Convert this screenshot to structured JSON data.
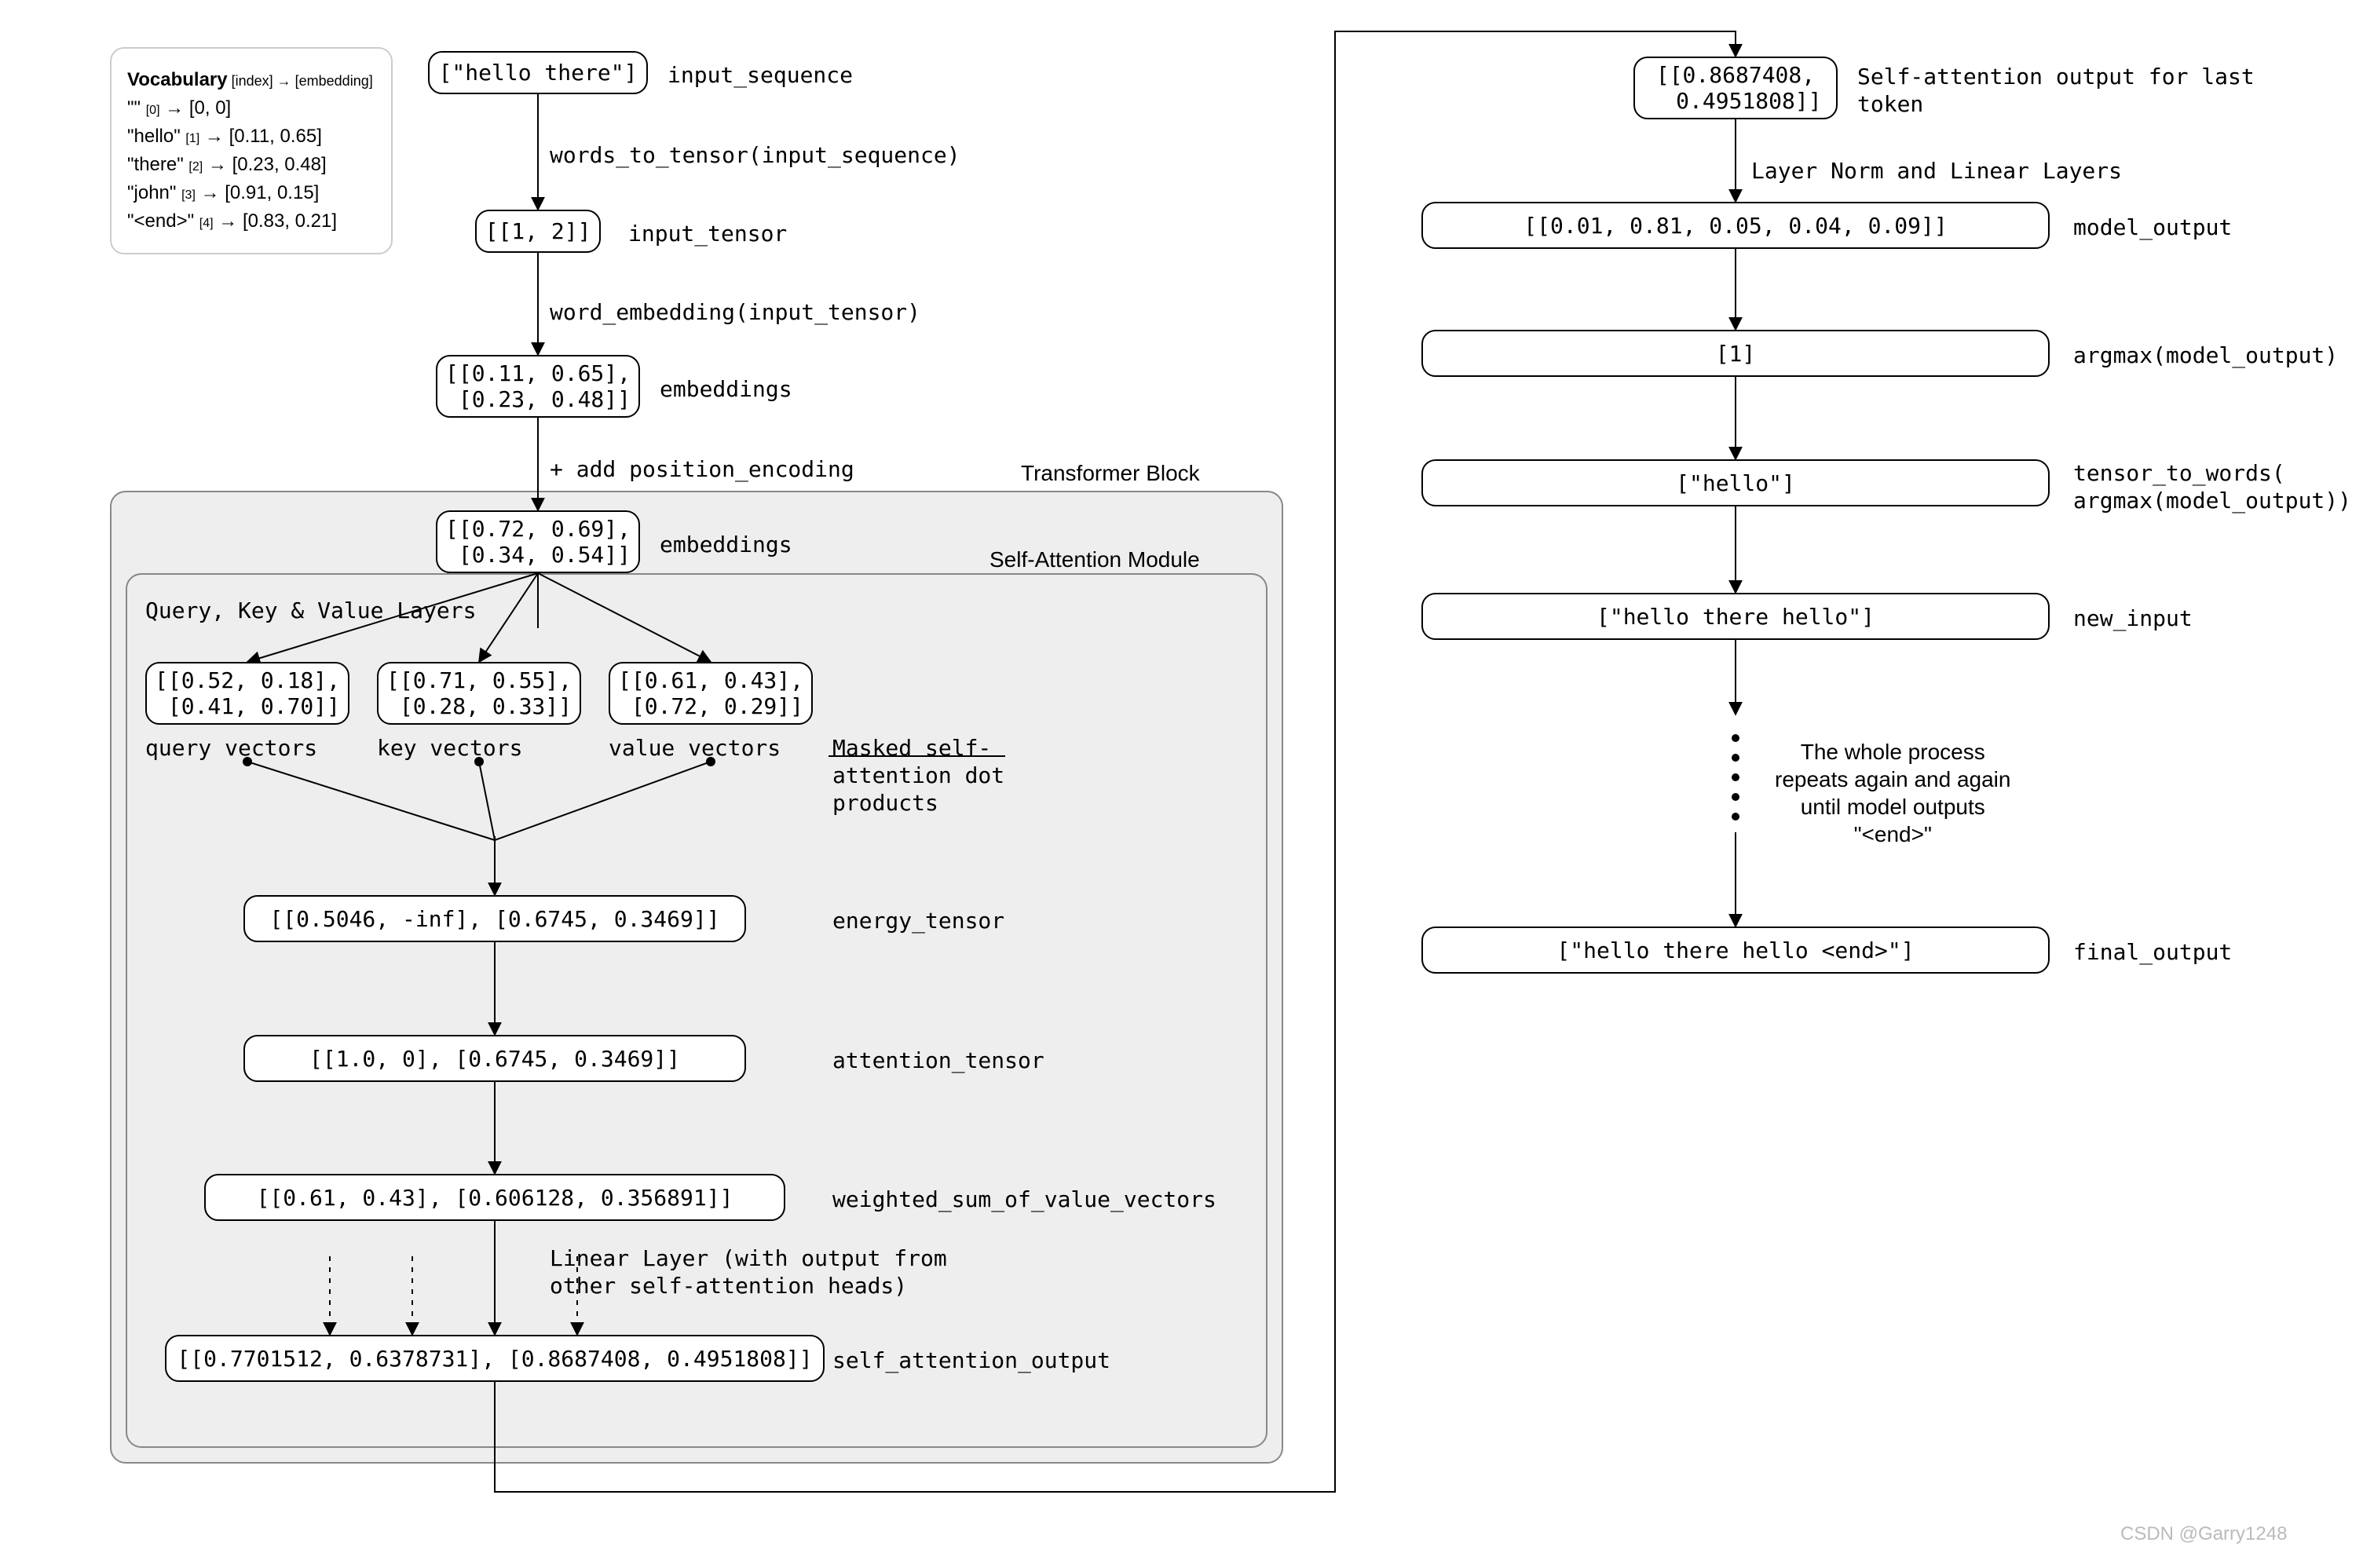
{
  "vocab": {
    "heading": "Vocabulary",
    "heading_meta": " [index] → [embedding]",
    "rows": [
      {
        "tok": "\"\"",
        "idx": "[0]",
        "emb": "[0, 0]"
      },
      {
        "tok": "\"hello\"",
        "idx": "[1]",
        "emb": "[0.11, 0.65]"
      },
      {
        "tok": "\"there\"",
        "idx": "[2]",
        "emb": "[0.23, 0.48]"
      },
      {
        "tok": "\"john\"",
        "idx": "[3]",
        "emb": "[0.91, 0.15]"
      },
      {
        "tok": "\"<end>\"",
        "idx": "[4]",
        "emb": "[0.83, 0.21]"
      }
    ]
  },
  "left": {
    "input_sequence": {
      "val": "[\"hello there\"]",
      "lbl": "input_sequence"
    },
    "step1": "words_to_tensor(input_sequence)",
    "input_tensor": {
      "val": "[[1, 2]]",
      "lbl": "input_tensor"
    },
    "step2": "word_embedding(input_tensor)",
    "embeddings1": {
      "val": "[[0.11, 0.65],\n [0.23, 0.48]]",
      "lbl": "embeddings"
    },
    "step3": "+ add position_encoding",
    "transformer_title": "Transformer Block",
    "self_attn_title": "Self-Attention Module",
    "embeddings2": {
      "val": "[[0.72, 0.69],\n [0.34, 0.54]]",
      "lbl": "embeddings"
    },
    "qkv_title": "Query, Key & Value Layers",
    "q": {
      "val": "[[0.52, 0.18],\n [0.41, 0.70]]",
      "lbl": "query vectors"
    },
    "k": {
      "val": "[[0.71, 0.55],\n [0.28, 0.33]]",
      "lbl": "key vectors"
    },
    "v": {
      "val": "[[0.61, 0.43],\n [0.72, 0.29]]",
      "lbl": "value vectors"
    },
    "mask_lbl": "Masked self-\nattention dot\nproducts",
    "energy": {
      "val": "[[0.5046, -inf], [0.6745, 0.3469]]",
      "lbl": "energy_tensor"
    },
    "attention": {
      "val": "[[1.0, 0], [0.6745, 0.3469]]",
      "lbl": "attention_tensor"
    },
    "wsum": {
      "val": "[[0.61, 0.43], [0.606128, 0.356891]]",
      "lbl": "weighted_sum_of_value_vectors"
    },
    "linear_lbl": "Linear Layer (with output from\nother self-attention heads)",
    "self_out": {
      "val": "[[0.7701512, 0.6378731], [0.8687408, 0.4951808]]",
      "lbl": "self_attention_output"
    }
  },
  "right": {
    "sa_last": {
      "val": "[[0.8687408,\n  0.4951808]]",
      "lbl": "Self-attention output for last\ntoken"
    },
    "step_ln": "Layer Norm and Linear Layers",
    "model_output": {
      "val": "[[0.01, 0.81, 0.05, 0.04, 0.09]]",
      "lbl": "model_output"
    },
    "argmax": {
      "val": "[1]",
      "lbl": "argmax(model_output)"
    },
    "t2w": {
      "val": "[\"hello\"]",
      "lbl": "tensor_to_words(\nargmax(model_output))"
    },
    "new_input": {
      "val": "[\"hello there hello\"]",
      "lbl": "new_input"
    },
    "repeat": "The whole process\nrepeats again and again\nuntil model outputs\n\"<end>\"",
    "final": {
      "val": "[\"hello there hello <end>\"]",
      "lbl": "final_output"
    }
  },
  "watermark": "CSDN @Garry1248"
}
